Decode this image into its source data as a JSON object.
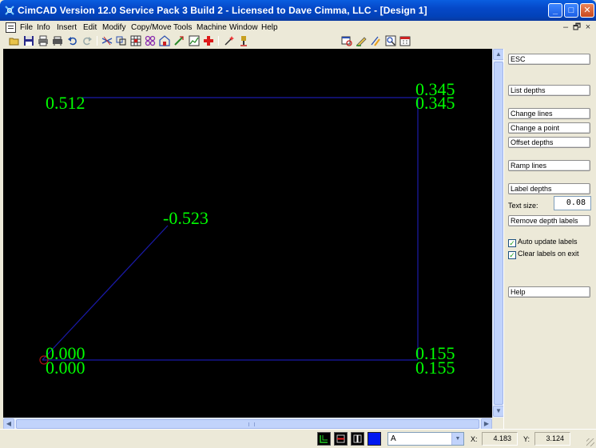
{
  "window": {
    "title": "CimCAD Version 12.0 Service Pack 3 Build 2 - Licensed to Dave Cimma, LLC - [Design 1]",
    "minimize_glyph": "_",
    "maximize_glyph": "□",
    "close_glyph": "✕"
  },
  "menu": {
    "items": [
      "File",
      "Info",
      "Insert",
      "Edit",
      "Modify",
      "Copy/Move",
      "Tools",
      "Machine",
      "Window",
      "Help"
    ],
    "mdi_minimize": "–",
    "mdi_restore": "🗗",
    "mdi_close": "×"
  },
  "toolbar": {
    "icons": [
      "open-folder-icon",
      "save-disk-icon",
      "print-icon",
      "print-preview-icon",
      "undo-icon",
      "redo-icon",
      "trim-lines-icon",
      "copy-shapes-icon",
      "grid-pattern-icon",
      "array-icon",
      "house-shape-icon",
      "dimension-icon",
      "chart-icon",
      "red-cross-icon",
      "wand-icon",
      "toolpath-icon",
      "view-window-icon",
      "pencil-icon",
      "depth-pencil-icon",
      "zoom-fit-icon",
      "calendar-icon"
    ]
  },
  "canvas": {
    "background": "#000000",
    "line_color": "#1a1aaa",
    "label_color": "#00ff00",
    "depth_labels": [
      "0.345",
      "0.345",
      "0.512",
      "-0.523",
      "0.000",
      "0.000",
      "0.155",
      "0.155"
    ]
  },
  "panel": {
    "esc": "ESC",
    "list_depths": "List depths",
    "change_lines": "Change lines",
    "change_point": "Change a point",
    "offset_depths": "Offset depths",
    "ramp_lines": "Ramp lines",
    "label_depths": "Label depths",
    "text_size_label": "Text size:",
    "text_size_value": "0.08",
    "remove_labels": "Remove depth labels",
    "auto_update": "Auto update labels",
    "auto_update_checked": true,
    "clear_on_exit": "Clear labels on exit",
    "clear_on_exit_checked": true,
    "help": "Help"
  },
  "status": {
    "layer": "A",
    "x_label": "X:",
    "x_value": "4.183",
    "y_label": "Y:",
    "y_value": "3.124"
  }
}
